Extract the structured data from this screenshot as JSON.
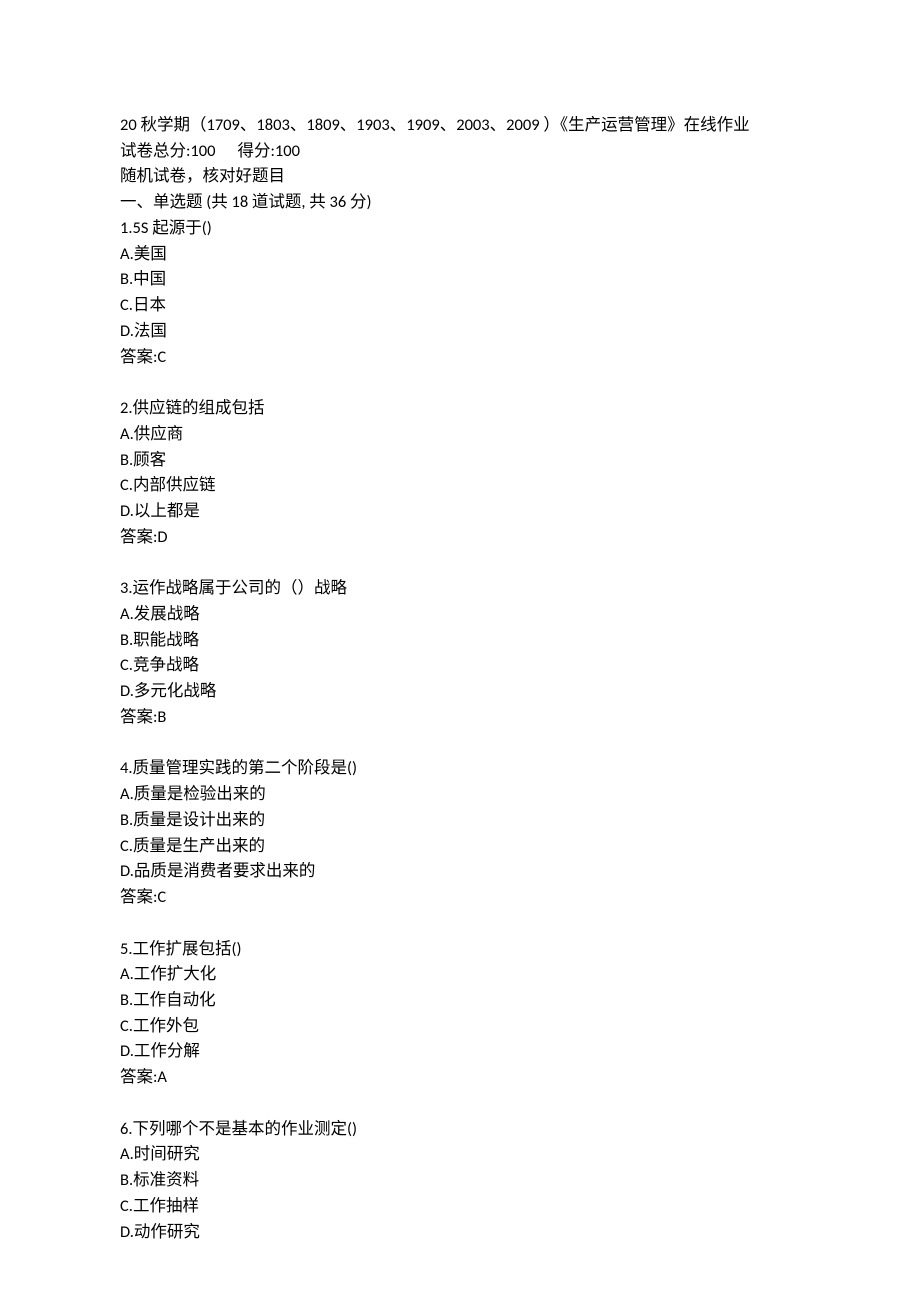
{
  "header": {
    "title_line": "20 秋学期（1709、1803、1809、1903、1909、2003、2009 ）《生产运营管理》在线作业",
    "score_label_total": "试卷总分:100",
    "score_label_got": "得分:100",
    "random_note": "随机试卷，核对好题目",
    "section1_title": "一、单选题 (共  18  道试题, 共  36  分)"
  },
  "questions": [
    {
      "stem": "1.5S 起源于()",
      "options": [
        "A.美国",
        "B.中国",
        "C.日本",
        "D.法国"
      ],
      "answer": "答案:C"
    },
    {
      "stem": "2.供应链的组成包括",
      "options": [
        "A.供应商",
        "B.顾客",
        "C.内部供应链",
        "D.以上都是"
      ],
      "answer": "答案:D"
    },
    {
      "stem": "3.运作战略属于公司的（）战略",
      "options": [
        "A.发展战略",
        "B.职能战略",
        "C.竞争战略",
        "D.多元化战略"
      ],
      "answer": "答案:B"
    },
    {
      "stem": "4.质量管理实践的第二个阶段是()",
      "options": [
        "A.质量是检验出来的",
        "B.质量是设计出来的",
        "C.质量是生产出来的",
        "D.品质是消费者要求出来的"
      ],
      "answer": "答案:C"
    },
    {
      "stem": "5.工作扩展包括()",
      "options": [
        "A.工作扩大化",
        "B.工作自动化",
        "C.工作外包",
        "D.工作分解"
      ],
      "answer": "答案:A"
    },
    {
      "stem": "6.下列哪个不是基本的作业测定()",
      "options": [
        "A.时间研究",
        "B.标准资料",
        "C.工作抽样",
        "D.动作研究"
      ],
      "answer": ""
    }
  ]
}
